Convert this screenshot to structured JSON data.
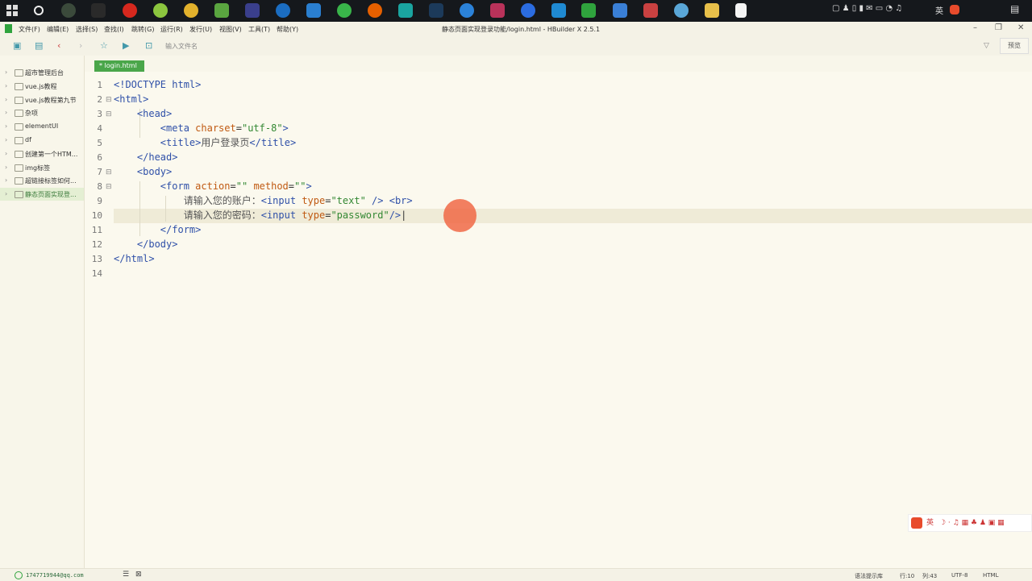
{
  "menubar": {
    "items": [
      "文件(F)",
      "编辑(E)",
      "选择(S)",
      "查找(I)",
      "跳转(G)",
      "运行(R)",
      "发行(U)",
      "视图(V)",
      "工具(T)",
      "帮助(Y)"
    ],
    "window_title": "静态页面实现登录功能/login.html - HBuilder X 2.5.1"
  },
  "toolbar": {
    "filter_placeholder": "输入文件名",
    "preview_label": "预览"
  },
  "sidebar": {
    "projects": [
      {
        "label": "超市管理后台"
      },
      {
        "label": "vue.js教程"
      },
      {
        "label": "vue.js教程第九节"
      },
      {
        "label": "杂项"
      },
      {
        "label": "elementUI"
      },
      {
        "label": "df"
      },
      {
        "label": "创建第一个HTM..."
      },
      {
        "label": "img标签"
      },
      {
        "label": "超链接标签如何..."
      },
      {
        "label": "静态页面实现登..."
      }
    ]
  },
  "tab": {
    "label": "* login.html"
  },
  "editor": {
    "line_numbers": [
      "1",
      "2",
      "3",
      "4",
      "5",
      "6",
      "7",
      "8",
      "9",
      "10",
      "11",
      "12",
      "13",
      "14"
    ],
    "current_line": 10
  },
  "ime": {
    "label": "英"
  },
  "statusbar": {
    "account": "1747719944@qq.com",
    "syntax_hint": "语法提示库",
    "row": "行:10",
    "col": "列:43",
    "encoding": "UTF-8",
    "language": "HTML"
  }
}
